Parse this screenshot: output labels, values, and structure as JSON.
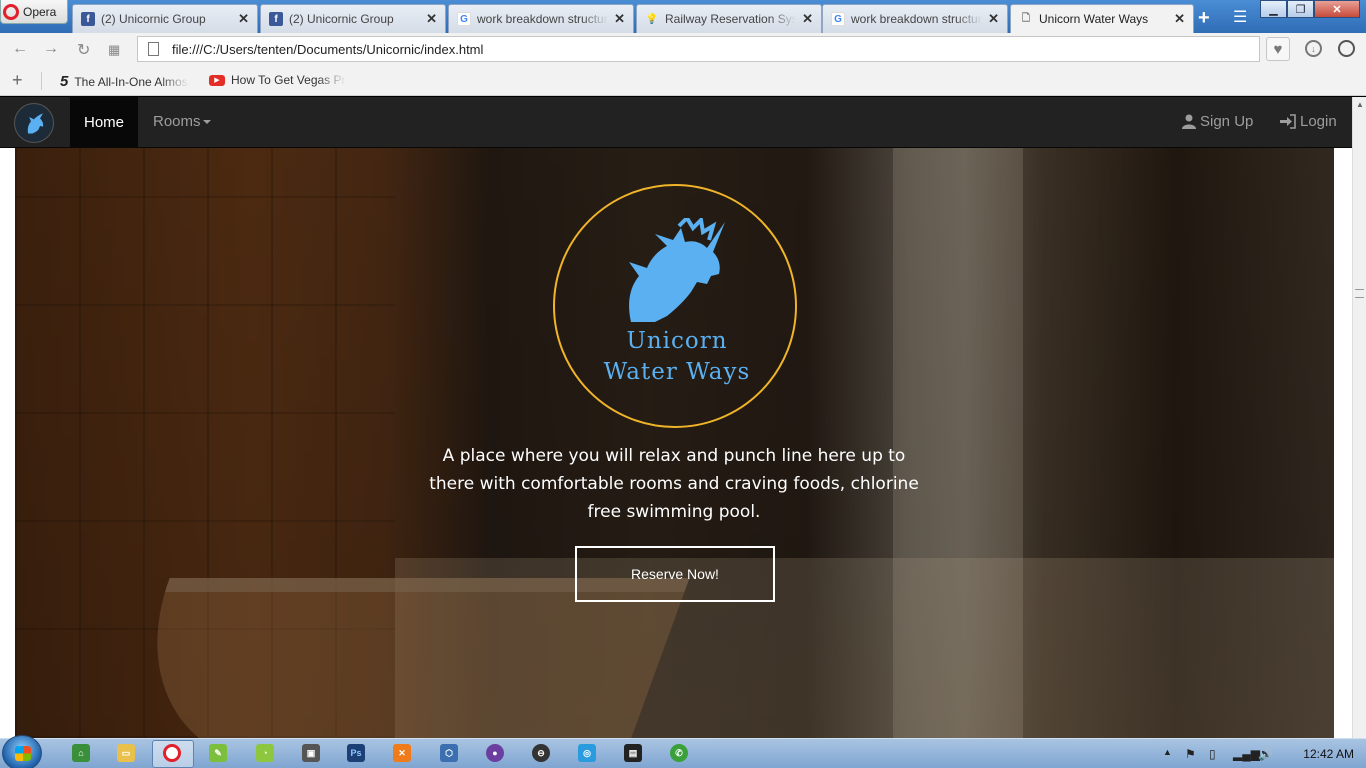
{
  "browser": {
    "opera_label": "Opera",
    "tabs": [
      {
        "label": "(2) Unicornic Group",
        "icon": "facebook-icon"
      },
      {
        "label": "(2) Unicornic Group",
        "icon": "facebook-icon"
      },
      {
        "label": "work breakdown structur",
        "icon": "google-icon"
      },
      {
        "label": "Railway Reservation Syste",
        "icon": "bulb-icon"
      },
      {
        "label": "work breakdown structur",
        "icon": "google-icon"
      },
      {
        "label": "Unicorn Water Ways",
        "icon": "page-icon",
        "active": true
      }
    ],
    "url": "file:///C:/Users/tenten/Documents/Unicornic/index.html",
    "bookmarks": [
      {
        "label": "The All-In-One Almos",
        "icon": "five-icon"
      },
      {
        "label": "How To Get Vegas Pr",
        "icon": "youtube-icon"
      }
    ]
  },
  "site": {
    "nav": {
      "home": "Home",
      "rooms": "Rooms",
      "signup": "Sign Up",
      "login": "Login"
    },
    "hero": {
      "brand_line1": "Unicorn",
      "brand_line2": "Water Ways",
      "tagline": "A place where you will relax and punch line here up to there with comfortable rooms and craving foods, chlorine free swimming pool.",
      "cta": "Reserve Now!"
    },
    "colors": {
      "navbar": "#222222",
      "accent_blue": "#5ab0f0",
      "emblem_ring": "#f0b429"
    }
  },
  "taskbar": {
    "clock": "12:42 AM"
  }
}
